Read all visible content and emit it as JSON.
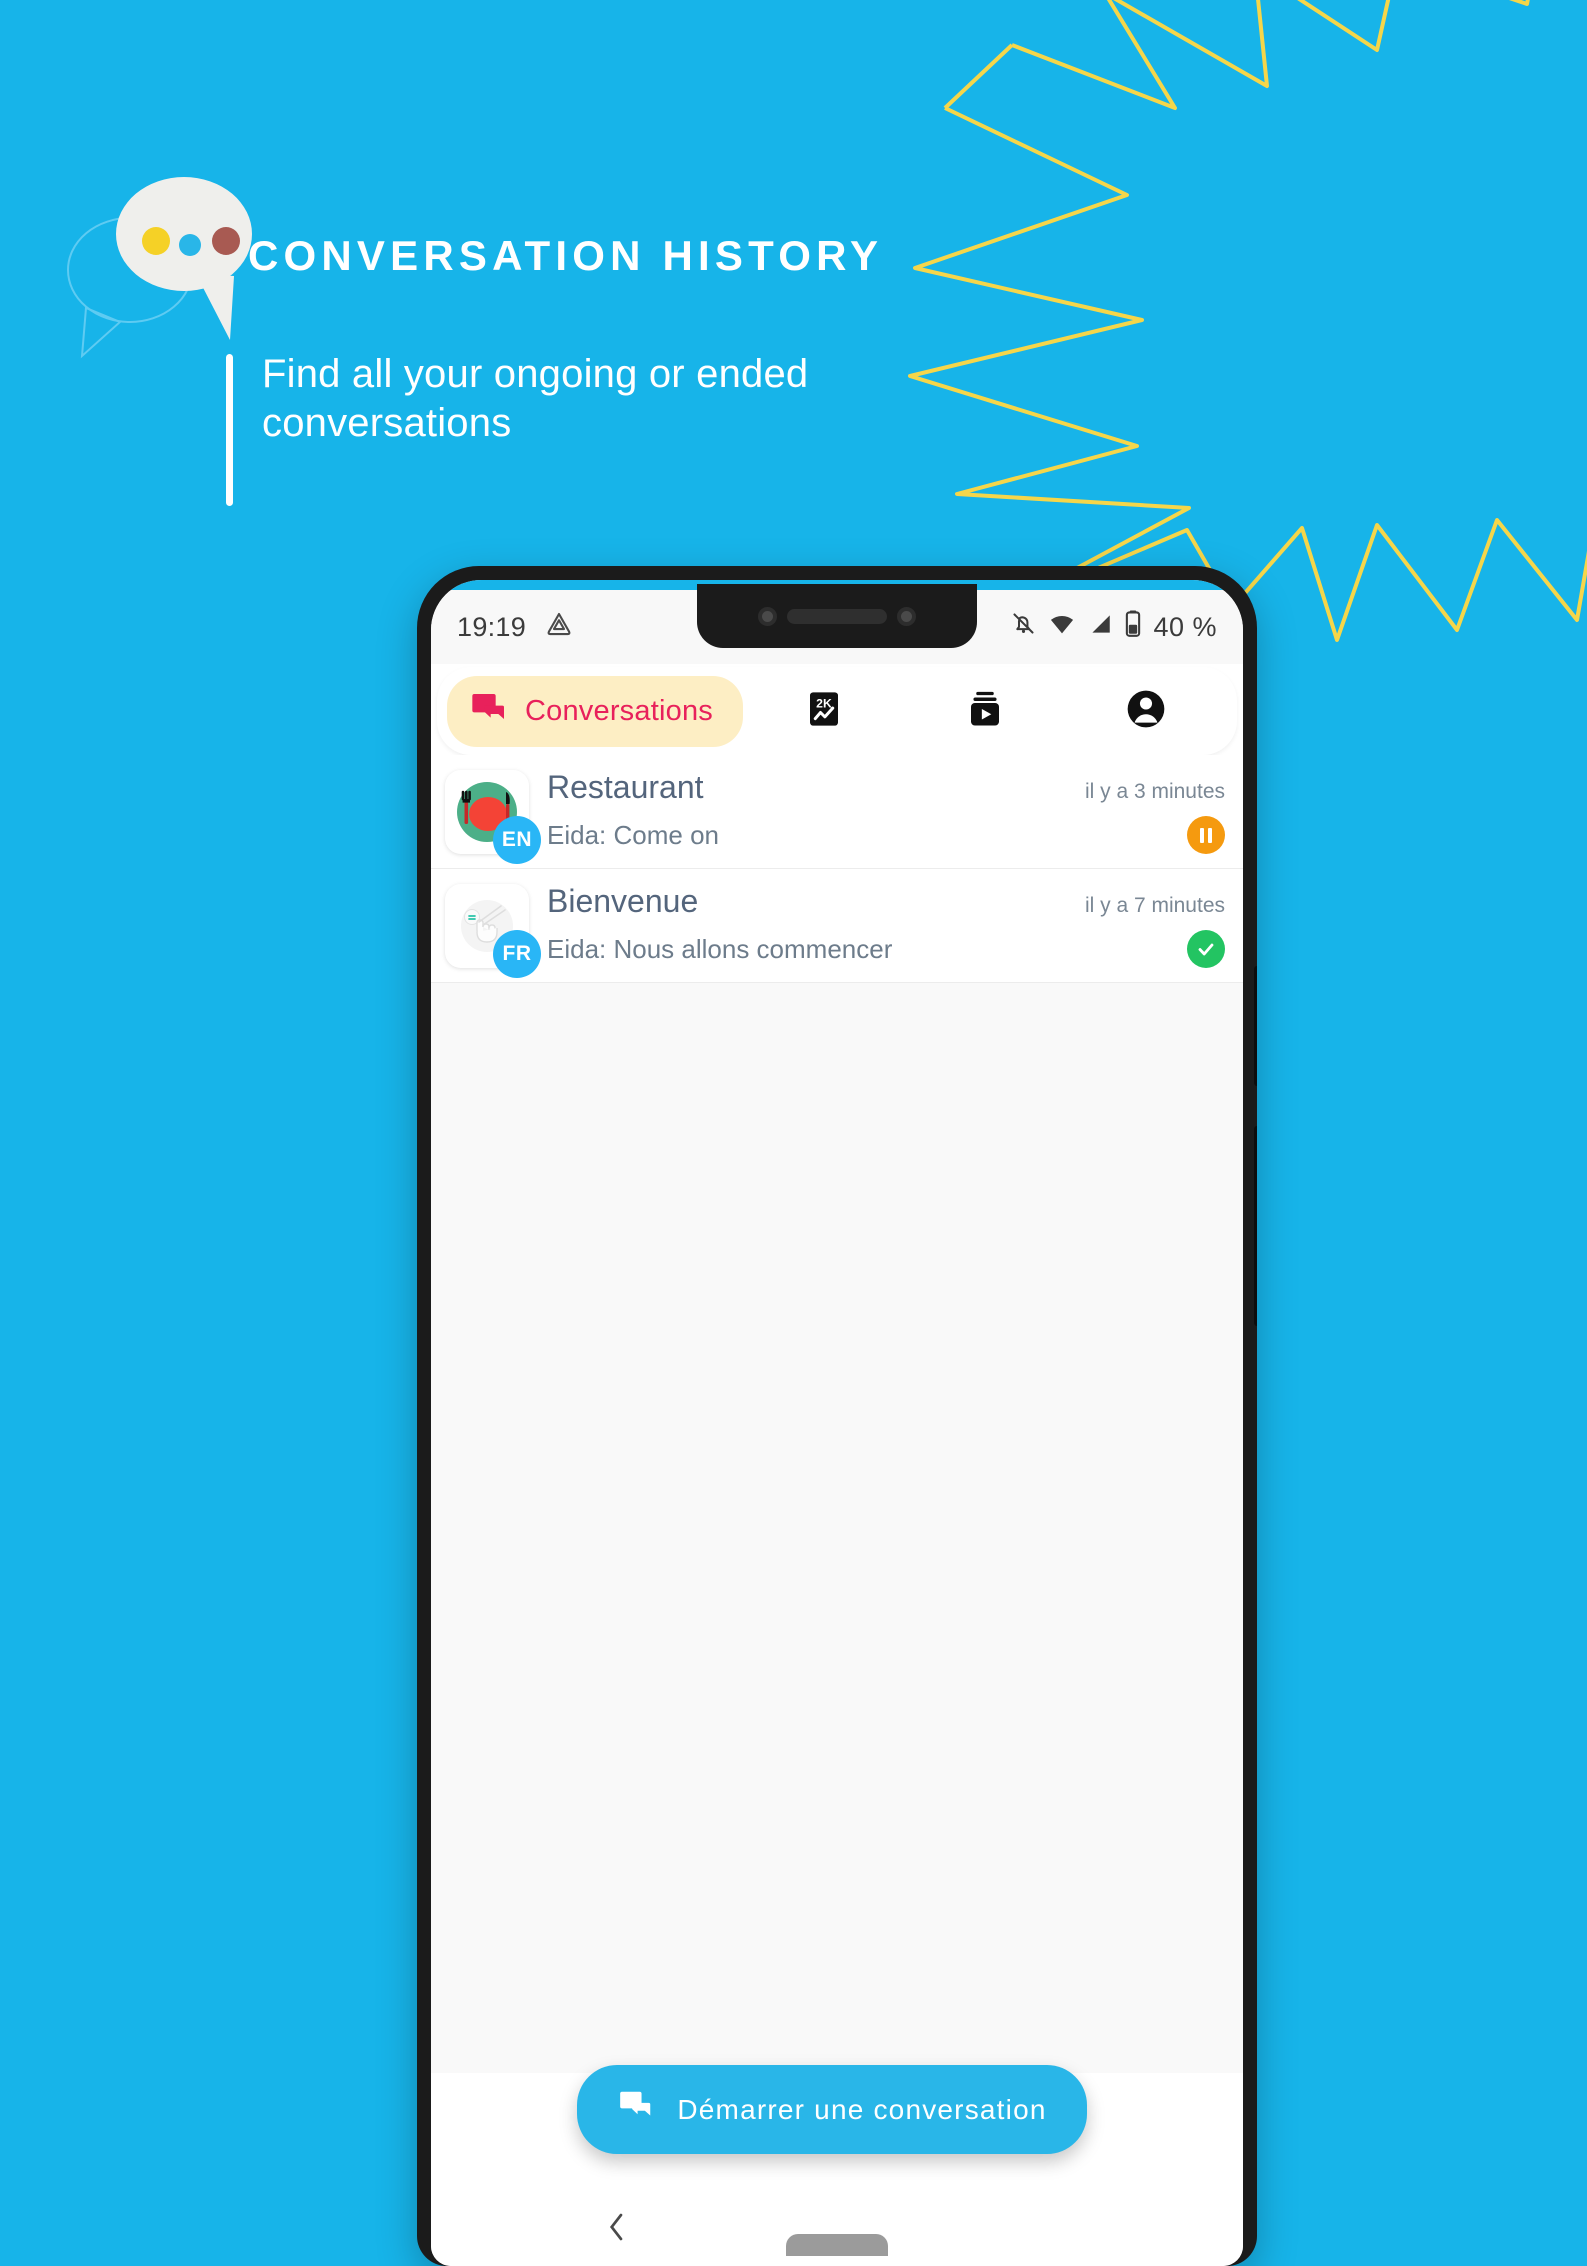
{
  "theme": {
    "background": "#17b4e9",
    "accent_pink": "#e8215b",
    "tab_pill": "#fdeec4",
    "fab_blue": "#29b6e8",
    "badge_blue": "#29b6f6",
    "status_pause": "#f59a0f",
    "status_done": "#23c462",
    "zigzag_yellow": "#f7d githubusercontent"
  },
  "hero": {
    "title": "CONVERSATION HISTORY",
    "subtitle": "Find all your ongoing or ended conversations",
    "logo_icon": "speech-bubble-icon",
    "logo_dots": [
      "#f5d126",
      "#29b6e8",
      "#a85a52"
    ]
  },
  "phone": {
    "status_bar": {
      "time": "19:19",
      "left_icon": "drive-triangle-icon",
      "icons": [
        "bell-muted-icon",
        "wifi-icon",
        "signal-icon",
        "battery-icon"
      ],
      "battery_text": "40 %"
    },
    "tabs": [
      {
        "label": "Conversations",
        "icon": "chat-bubbles-icon",
        "active": true
      },
      {
        "label": "",
        "icon": "analytics-2k-icon",
        "active": false
      },
      {
        "label": "",
        "icon": "video-library-icon",
        "active": false
      },
      {
        "label": "",
        "icon": "account-circle-icon",
        "active": false
      }
    ],
    "conversations": [
      {
        "title": "Restaurant",
        "snippet": "Eida: Come on",
        "time": "il y a 3 minutes",
        "language": "EN",
        "avatar_icon": "restaurant-plate-icon",
        "status": "paused",
        "status_icon": "pause-icon"
      },
      {
        "title": "Bienvenue",
        "snippet": "Eida: Nous allons commencer",
        "time": "il y a 7 minutes",
        "language": "FR",
        "avatar_icon": "hand-tap-icon",
        "status": "ended",
        "status_icon": "check-icon"
      }
    ],
    "fab": {
      "label": "Démarrer une conversation",
      "icon": "chat-bubbles-icon"
    },
    "nav_bar": {
      "back_icon": "back-chevron-icon",
      "home_icon": "home-pill-icon"
    }
  }
}
